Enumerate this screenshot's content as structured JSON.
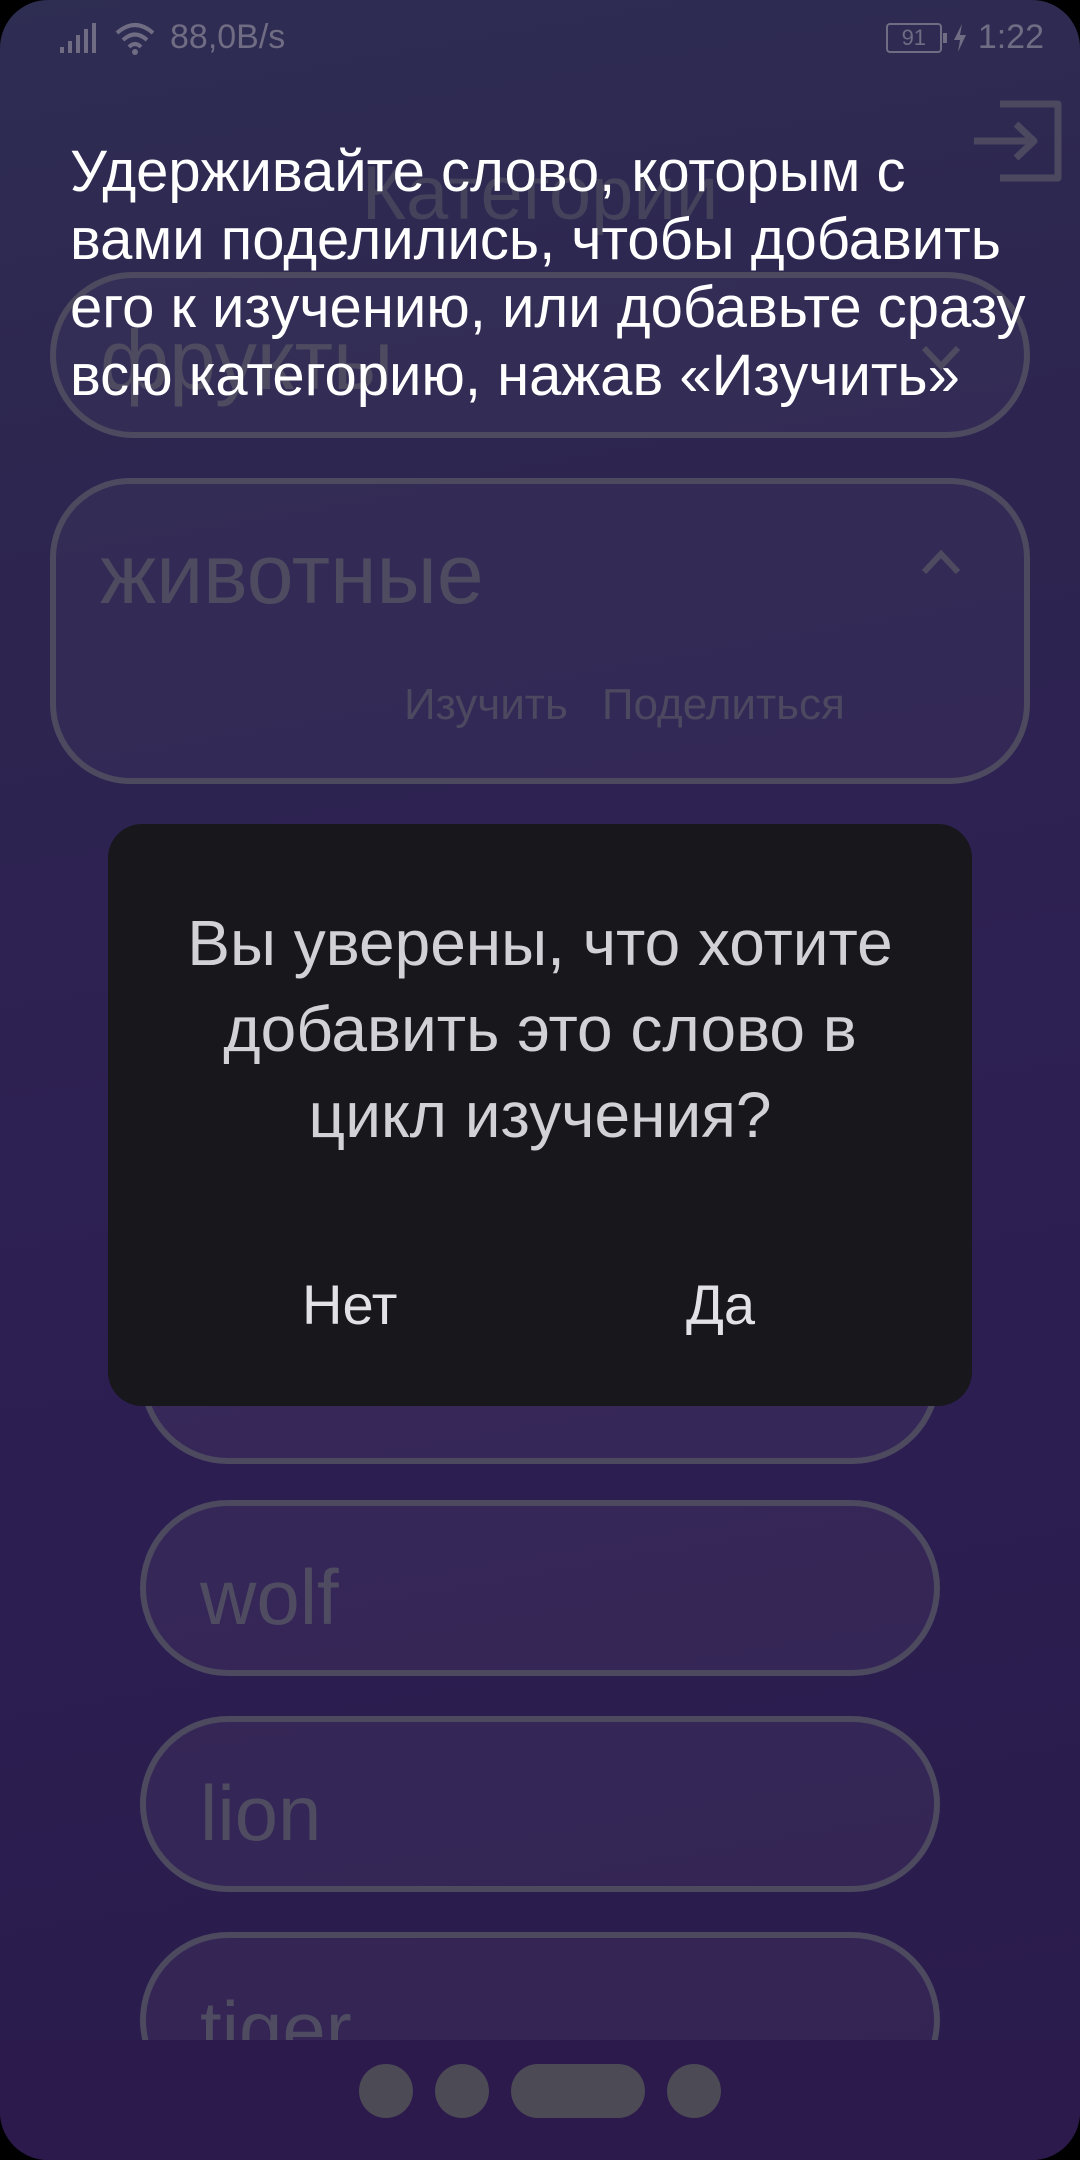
{
  "status_bar": {
    "network_speed": "88,0B/s",
    "battery": "91",
    "time": "1:22"
  },
  "page": {
    "title": "Категории",
    "categories": [
      {
        "name": "фрукты",
        "expanded": false
      },
      {
        "name": "животные",
        "expanded": true,
        "actions": [
          "Изучить",
          "Поделиться"
        ]
      }
    ],
    "words": [
      "wolf",
      "lion",
      "tiger"
    ]
  },
  "hint": {
    "text": "Удерживайте слово, которым с вами поделились, чтобы добавить его к изучению, или добавьте сразу всю категорию, нажав «Изучить»"
  },
  "dialog": {
    "message": "Вы уверены, что хотите добавить это слово в цикл изучения?",
    "no_label": "Нет",
    "yes_label": "Да"
  },
  "pager": {
    "count": 4,
    "active_index": 2
  }
}
